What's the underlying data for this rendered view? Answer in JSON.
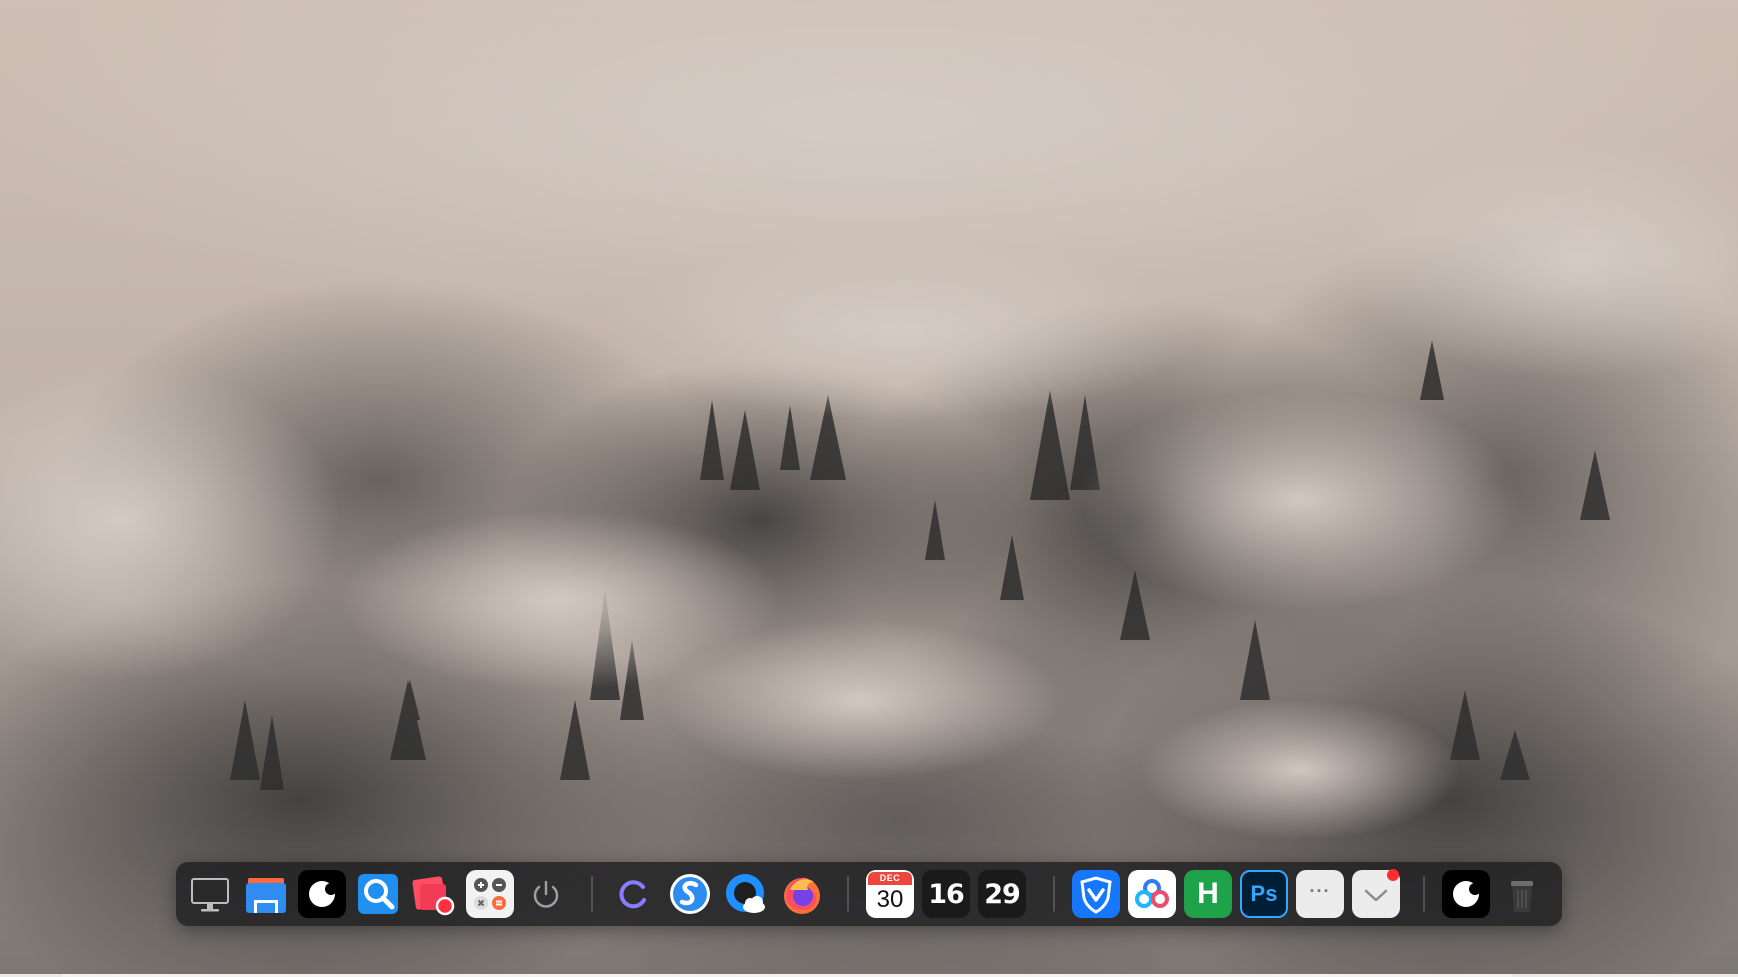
{
  "desktop": {
    "wallpaper": "foggy forest landscape",
    "colors": {
      "sky": "#cdbfb4",
      "fog": "#b3aaa3",
      "trees_dark": "#2f2f2f",
      "trees_mid": "#4e4b49"
    }
  },
  "dock": {
    "colors": {
      "background": "#1e1e21",
      "separator": "#4a4a4a"
    },
    "items": [
      {
        "id": "show-desktop",
        "icon": "monitor-icon"
      },
      {
        "id": "file-manager",
        "icon": "folder-icon"
      },
      {
        "id": "app-black-circle-1",
        "icon": "circle-icon"
      },
      {
        "id": "search",
        "icon": "search-icon"
      },
      {
        "id": "screenshot",
        "icon": "screenshot-icon"
      },
      {
        "id": "calculator",
        "icon": "calculator-icon"
      },
      {
        "id": "power",
        "icon": "power-icon"
      },
      {
        "id": "loading",
        "icon": "spinner-icon"
      },
      {
        "id": "browser-s",
        "icon": "s-browser-icon"
      },
      {
        "id": "browser-cloud",
        "icon": "cloud-browser-icon"
      },
      {
        "id": "firefox",
        "icon": "firefox-icon"
      },
      {
        "id": "calendar",
        "icon": "calendar-icon",
        "month": "DEC",
        "day": "30"
      },
      {
        "id": "clock-hour",
        "icon": "hour-icon",
        "text": "16"
      },
      {
        "id": "clock-minute",
        "icon": "minute-icon",
        "text": "29"
      },
      {
        "id": "vpn",
        "icon": "shield-check-icon"
      },
      {
        "id": "baidu-netdisk",
        "icon": "cloud-rings-icon"
      },
      {
        "id": "hbuilder",
        "icon": "h-icon",
        "text": "H"
      },
      {
        "id": "photoshop",
        "icon": "ps-icon",
        "text": "Ps"
      },
      {
        "id": "more-apps",
        "icon": "more-icon",
        "text": "···"
      },
      {
        "id": "mail",
        "icon": "mail-icon",
        "badge": true
      },
      {
        "id": "app-black-circle-2",
        "icon": "circle-icon"
      },
      {
        "id": "trash",
        "icon": "trash-icon"
      }
    ]
  }
}
